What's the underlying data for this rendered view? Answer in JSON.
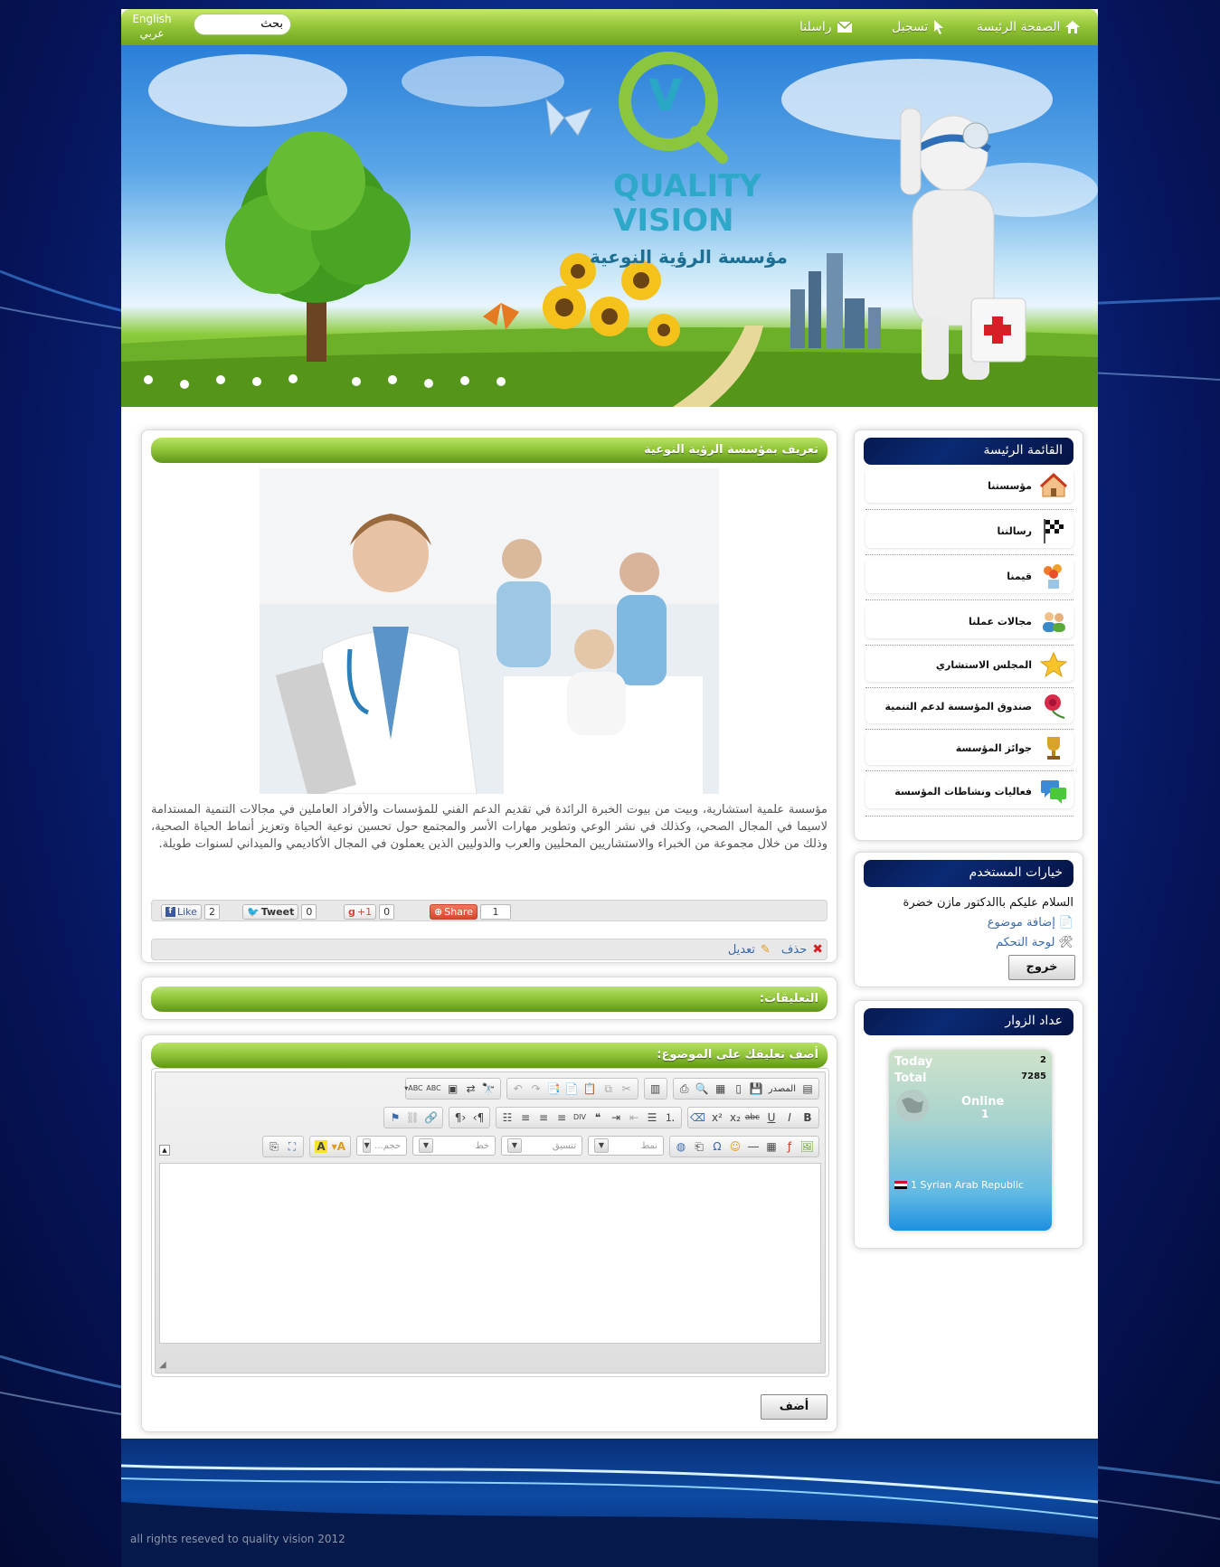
{
  "nav": {
    "home": "الصفحة الرئيسة",
    "register": "تسجيل",
    "contact": "راسلنا",
    "search_value": "بحث",
    "lang_en": "English",
    "lang_ar": "عربي"
  },
  "banner": {
    "logo_line1": "QUALITY",
    "logo_line2": "VISION",
    "logo_arabic": "مؤسسة الرؤية النوعية",
    "logo_letter": "V"
  },
  "article": {
    "title": "تعريف بمؤسسة الرؤية النوعية",
    "body": "مؤسسة علمية استشارية، وبيت من بيوت الخبرة الرائدة في تقديم الدعم الفني للمؤسسات والأفراد العاملين في مجالات التنمية المستدامة لاسيما في المجال الصحي، وكذلك في نشر الوعي وتطوير مهارات الأسر والمجتمع حول تحسين نوعية الحياة وتعزيز أنماط الحياة الصحية، وذلك من خلال مجموعة من الخبراء والاستشاريين المحليين والعرب والدوليين الذين يعملون في المجال الأكاديمي والميداني لسنوات طويلة.",
    "social": {
      "like_label": "Like",
      "like_count": "2",
      "tweet_label": "Tweet",
      "tweet_count": "0",
      "gplus_label": "+1",
      "gplus_count": "0",
      "share_label": "Share",
      "share_count": "1"
    },
    "delete_label": "حذف",
    "edit_label": "تعديل"
  },
  "comments": {
    "title": "التعليقات:",
    "add_title": "أضف تعليقك على الموضوع:",
    "source_label": "المصدر",
    "style_placeholder": "نمط",
    "format_placeholder": "تنسيق",
    "font_placeholder": "خط",
    "size_placeholder": "حجم...",
    "submit_label": "أضف"
  },
  "sidebar": {
    "main_menu_title": "القائمة الرئيسة",
    "items": [
      {
        "label": "مؤسستنا",
        "icon": "house-icon"
      },
      {
        "label": "رسالتنا",
        "icon": "checkered-flag-icon"
      },
      {
        "label": "قيمنا",
        "icon": "flowers-icon"
      },
      {
        "label": "مجالات عملنا",
        "icon": "users-icon"
      },
      {
        "label": "المجلس الاستشاري",
        "icon": "star-icon"
      },
      {
        "label": "صندوق المؤسسة لدعم التنمية",
        "icon": "rose-icon"
      },
      {
        "label": "جوائز المؤسسة",
        "icon": "trophy-icon"
      },
      {
        "label": "فعاليات ونشاطات المؤسسة",
        "icon": "chat-icon"
      }
    ],
    "user_title": "خيارات المستخدم",
    "greeting": "السلام عليكم باالدكتور مازن خضرة",
    "add_topic": "إضافة موضوع",
    "control_panel": "لوحة التحكم",
    "logout": "خروج",
    "visitors_title": "عداد الزوار",
    "today_label": "Today",
    "today_value": "2",
    "total_label": "Total",
    "total_value": "7285",
    "online_label": "Online",
    "online_value": "1",
    "country": "1 Syrian Arab Republic"
  },
  "footer": {
    "copyright": "all rights reseved to quality vision 2012"
  },
  "colors": {
    "accent_green": "#8fc337",
    "navy": "#0b2a74",
    "link_blue": "#3a6aa8"
  }
}
